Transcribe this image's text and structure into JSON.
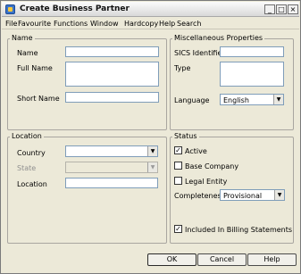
{
  "window": {
    "title": "Create Business Partner",
    "minimize_glyph": "_",
    "maximize_glyph": "□",
    "close_glyph": "×"
  },
  "menu": [
    "File",
    "Favourite",
    "Functions",
    "Window",
    "Hardcopy",
    "Help",
    "Search"
  ],
  "name_group": {
    "title": "Name",
    "name_label": "Name",
    "name_value": "",
    "full_name_label": "Full Name",
    "full_name_value": "",
    "short_name_label": "Short Name",
    "short_name_value": ""
  },
  "misc_group": {
    "title": "Miscellaneous Properties",
    "sics_label": "SICS Identifier",
    "sics_value": "",
    "type_label": "Type",
    "type_value": "",
    "language_label": "Language",
    "language_value": "English"
  },
  "location_group": {
    "title": "Location",
    "country_label": "Country",
    "country_value": "",
    "state_label": "State",
    "state_value": "",
    "location_label": "Location",
    "location_value": ""
  },
  "status_group": {
    "title": "Status",
    "active_label": "Active",
    "active_checked": true,
    "base_company_label": "Base Company",
    "base_company_checked": false,
    "legal_entity_label": "Legal Entity",
    "legal_entity_checked": false,
    "completeness_label": "Completeness",
    "completeness_value": "Provisional",
    "billing_label": "Included In Billing Statements",
    "billing_checked": true
  },
  "buttons": {
    "ok": "OK",
    "cancel": "Cancel",
    "help": "Help"
  },
  "combo_arrow": "▼",
  "check_mark": "✓"
}
